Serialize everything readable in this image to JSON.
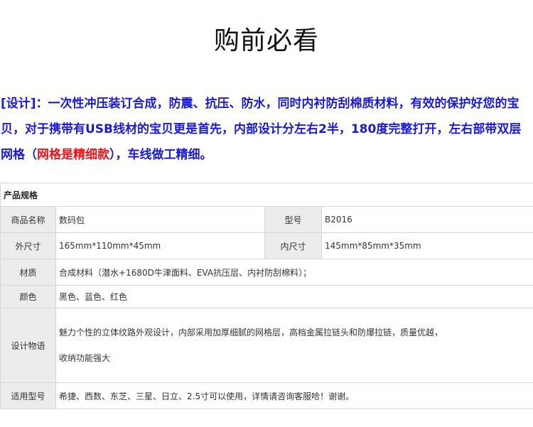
{
  "title": "购前必看",
  "intro": {
    "part1": "[设计]：一次性冲压装订合成，防震、抗压、防水，同时内衬防刮棉质材料，有效的保护好您的宝贝，对于携带有USB线材的宝贝更是首先，内部设计分左右2半，180度完整打开，左右部带双层网格（",
    "highlight": "网格是精细款",
    "part2": "），车线做工精细。"
  },
  "spec_table": {
    "header": "产品规格",
    "name_label": "商品名称",
    "name_value": "数码包",
    "model_label": "型号",
    "model_value": "B2016",
    "outer_label": "外尺寸",
    "outer_value": "165mm*110mm*45mm",
    "inner_label": "内尺寸",
    "inner_value": "145mm*85mm*35mm",
    "material_label": "材质",
    "material_value": "合成材料（潜水+1680D牛津面料、EVA抗压层、内衬防刮棉料）；",
    "color_label": "颜色",
    "color_value": "黑色、蓝色、红色",
    "design_label": "设计物语",
    "design_value": "魅力个性的立体纹路外观设计，内部采用加厚细腻的网格层，高档金属拉链头和防爆拉链，质量优越，收纳功能强大",
    "fit_label": "适用型号",
    "fit_value": "希捷、西数、东芝、三星、日立、2.5寸可以使用，详情请咨询客服哈！谢谢。"
  },
  "colors": {
    "intro_text": "#1a1ad6",
    "highlight": "#e8141b",
    "label_bg": "#ececec",
    "border": "#d6d6d6"
  }
}
